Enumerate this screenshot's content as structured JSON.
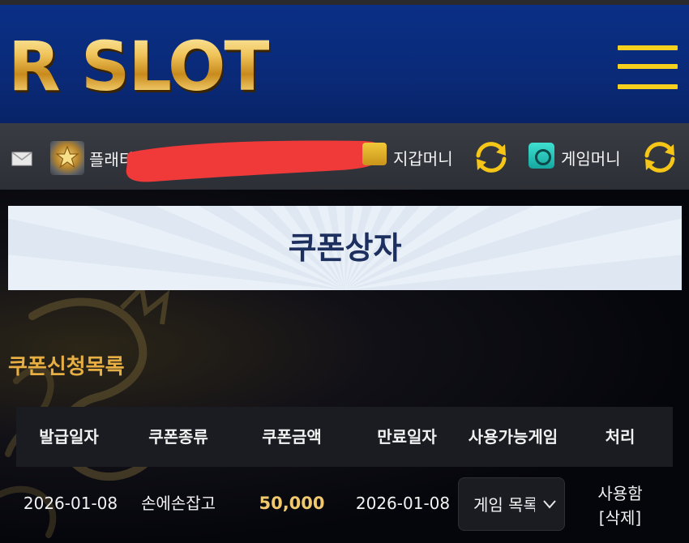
{
  "header": {
    "logo_text": "R SLOT",
    "menu_icon": "hamburger-menu-icon"
  },
  "userbar": {
    "mail_icon": "envelope-icon",
    "rank_icon": "gold-rank-badge-icon",
    "rank_name": "플래티넘",
    "wallet_icon": "wallet-icon",
    "wallet_label": "지갑머니",
    "refresh_icon": "refresh-arrows-icon",
    "game_icon": "safe-icon",
    "game_label": "게임머니"
  },
  "page": {
    "title": "쿠폰상자",
    "section_title": "쿠폰신청목록"
  },
  "table": {
    "columns": [
      "발급일자",
      "쿠폰종류",
      "쿠폰금액",
      "만료일자",
      "사용가능게임",
      "처리"
    ],
    "rows": [
      {
        "issue_date": "2026-01-08",
        "coupon_type": "손에손잡고",
        "amount": "50,000",
        "expire_date": "2026-01-08",
        "game_select": "게임 목록",
        "status": "사용함",
        "delete_label": "[삭제]"
      }
    ]
  },
  "colors": {
    "header_blue": "#0a2a78",
    "accent_gold": "#e7ae43",
    "menu_yellow": "#f5d11e",
    "amount_gold": "#f0c86e",
    "title_navy": "#1d2f5e",
    "redaction_red": "#f03a3a"
  }
}
